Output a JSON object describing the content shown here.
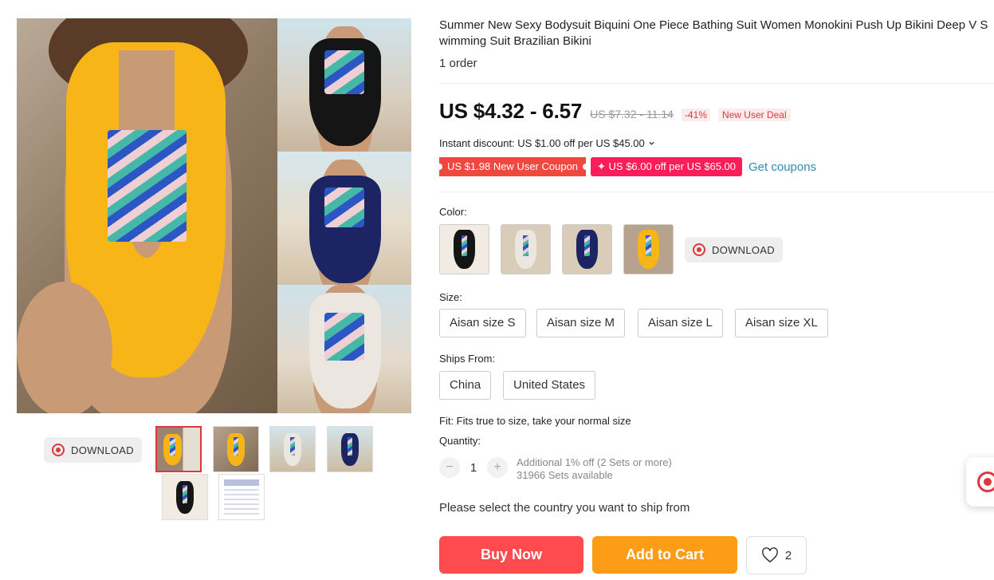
{
  "product": {
    "title": "Summer New Sexy Bodysuit Biquini One Piece Bathing Suit Women Monokini Push Up Bikini Deep V Swimming Suit Brazilian Bikini",
    "orders": "1 order"
  },
  "price": {
    "current": "US $4.32 - 6.57",
    "original": "US $7.32 - 11.14",
    "discount": "-41%",
    "deal_badge": "New User Deal",
    "instant_discount": "Instant discount: US $1.00 off per US $45.00",
    "coupon_new_user": "US $1.98 New User Coupon",
    "coupon_store": "✦ US $6.00 off per US $65.00",
    "get_coupons": "Get coupons"
  },
  "gallery": {
    "download_label": "DOWNLOAD",
    "thumbnails": [
      "yellow collage",
      "yellow",
      "white",
      "navy",
      "black",
      "size chart"
    ]
  },
  "color": {
    "label": "Color:",
    "options": [
      "Black",
      "White",
      "Navy",
      "Yellow"
    ],
    "download_label": "DOWNLOAD"
  },
  "size": {
    "label": "Size:",
    "options": [
      "Aisan size S",
      "Aisan size M",
      "Aisan size L",
      "Aisan size XL"
    ]
  },
  "ships_from": {
    "label": "Ships From:",
    "options": [
      "China",
      "United States"
    ]
  },
  "fit": "Fit: Fits true to size, take your normal size",
  "quantity": {
    "label": "Quantity:",
    "value": "1",
    "minus": "−",
    "plus": "+",
    "additional": "Additional 1% off (2 Sets or more)",
    "available": "31966 Sets available"
  },
  "ship_message": "Please select the country you want to ship from",
  "actions": {
    "buy_now": "Buy Now",
    "add_to_cart": "Add to Cart",
    "wishlist_count": "2"
  },
  "colors": {
    "accent_red": "#e0373f",
    "buy_now_bg": "#fd4b4f",
    "add_to_cart_bg": "#fd9c17",
    "coupon_red": "#f2473f",
    "coupon_pink": "#fd1d58",
    "link_blue": "#2e8ab8"
  },
  "icons": [
    "target-icon",
    "chevron-down-icon",
    "heart-icon"
  ]
}
